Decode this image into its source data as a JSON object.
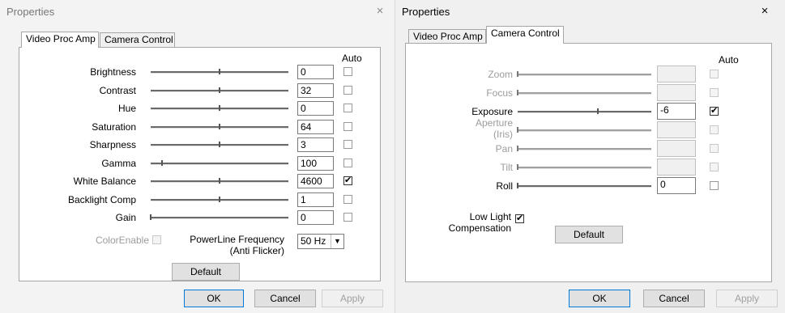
{
  "left": {
    "title": "Properties",
    "close": "×",
    "tabs": [
      {
        "label": "Video Proc Amp"
      },
      {
        "label": "Camera Control"
      }
    ],
    "auto_label": "Auto",
    "rows": [
      {
        "label": "Brightness",
        "value": "0",
        "auto": false,
        "level": 0.5
      },
      {
        "label": "Contrast",
        "value": "32",
        "auto": false,
        "level": 0.5
      },
      {
        "label": "Hue",
        "value": "0",
        "auto": false,
        "level": 0.5
      },
      {
        "label": "Saturation",
        "value": "64",
        "auto": false,
        "level": 0.5
      },
      {
        "label": "Sharpness",
        "value": "3",
        "auto": false,
        "level": 0.5
      },
      {
        "label": "Gamma",
        "value": "100",
        "auto": false,
        "level": 0.08
      },
      {
        "label": "White Balance",
        "value": "4600",
        "auto": true,
        "check": "✔",
        "level": 0.5
      },
      {
        "label": "Backlight Comp",
        "value": "1",
        "auto": false,
        "level": 0.5
      },
      {
        "label": "Gain",
        "value": "0",
        "auto": false,
        "level": 0.0
      }
    ],
    "color_enable": "ColorEnable",
    "powerline": {
      "line1": "PowerLine Frequency",
      "line2": "(Anti Flicker)",
      "value": "50 Hz",
      "arrow": "▼"
    },
    "default_label": "Default",
    "ok_label": "OK",
    "cancel_label": "Cancel",
    "apply_label": "Apply"
  },
  "right": {
    "title": "Properties",
    "close": "×",
    "tabs": [
      {
        "label": "Video Proc Amp"
      },
      {
        "label": "Camera Control"
      }
    ],
    "auto_label": "Auto",
    "rows": [
      {
        "label": "Zoom",
        "value": "",
        "enabled": false,
        "auto": false,
        "level": 0.0
      },
      {
        "label": "Focus",
        "value": "",
        "enabled": false,
        "auto": false,
        "level": 0.0
      },
      {
        "label": "Exposure",
        "value": "-6",
        "enabled": true,
        "auto": true,
        "check": "✔",
        "level": 0.6
      },
      {
        "label": "Aperture\n(Iris)",
        "value": "",
        "enabled": false,
        "auto": false,
        "level": 0.0
      },
      {
        "label": "Pan",
        "value": "",
        "enabled": false,
        "auto": false,
        "level": 0.0
      },
      {
        "label": "Tilt",
        "value": "",
        "enabled": false,
        "auto": false,
        "level": 0.0
      },
      {
        "label": "Roll",
        "value": "0",
        "enabled": true,
        "auto": false,
        "level": 0.0
      }
    ],
    "low_light": {
      "line1": "Low Light",
      "line2": "Compensation",
      "check": "✔"
    },
    "default_label": "Default",
    "ok_label": "OK",
    "cancel_label": "Cancel",
    "apply_label": "Apply"
  }
}
